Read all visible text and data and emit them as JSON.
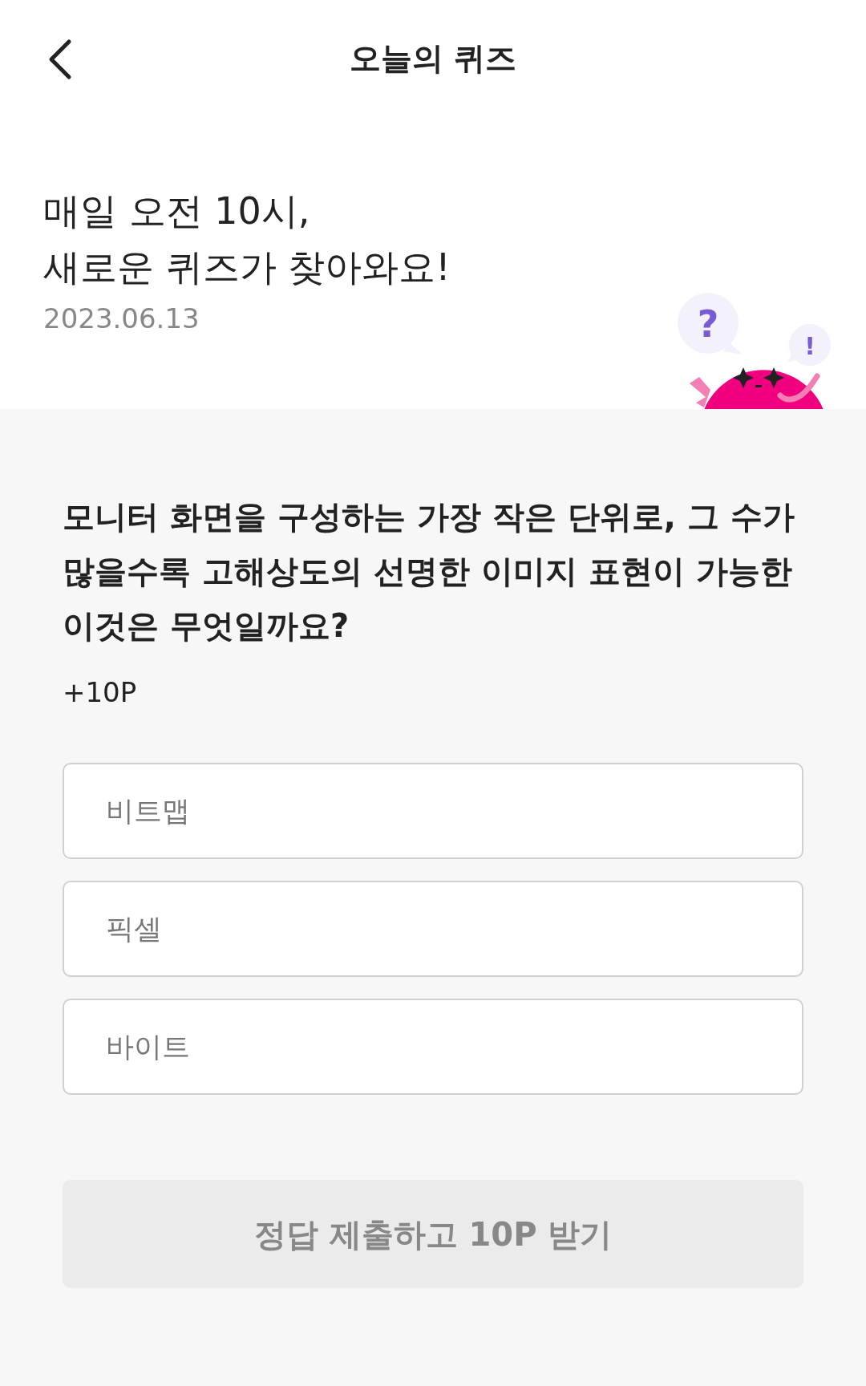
{
  "header": {
    "title": "오늘의 퀴즈"
  },
  "intro": {
    "lines": [
      "매일 오전 10시,",
      "새로운 퀴즈가 찾아와요!"
    ],
    "date": "2023.06.13",
    "mascot": {
      "question_mark": "?",
      "exclaim_mark": "!"
    }
  },
  "quiz": {
    "question": "모니터 화면을 구성하는 가장 작은 단위로, 그 수가 많을수록 고해상도의 선명한 이미지 표현이 가능한 이것은 무엇일까요?",
    "points": "+10P",
    "options": [
      {
        "label": "비트맵",
        "selected": false
      },
      {
        "label": "픽셀",
        "selected": false
      },
      {
        "label": "바이트",
        "selected": false
      }
    ]
  },
  "submit": {
    "label": "정답 제출하고 10P 받기",
    "disabled": true
  }
}
